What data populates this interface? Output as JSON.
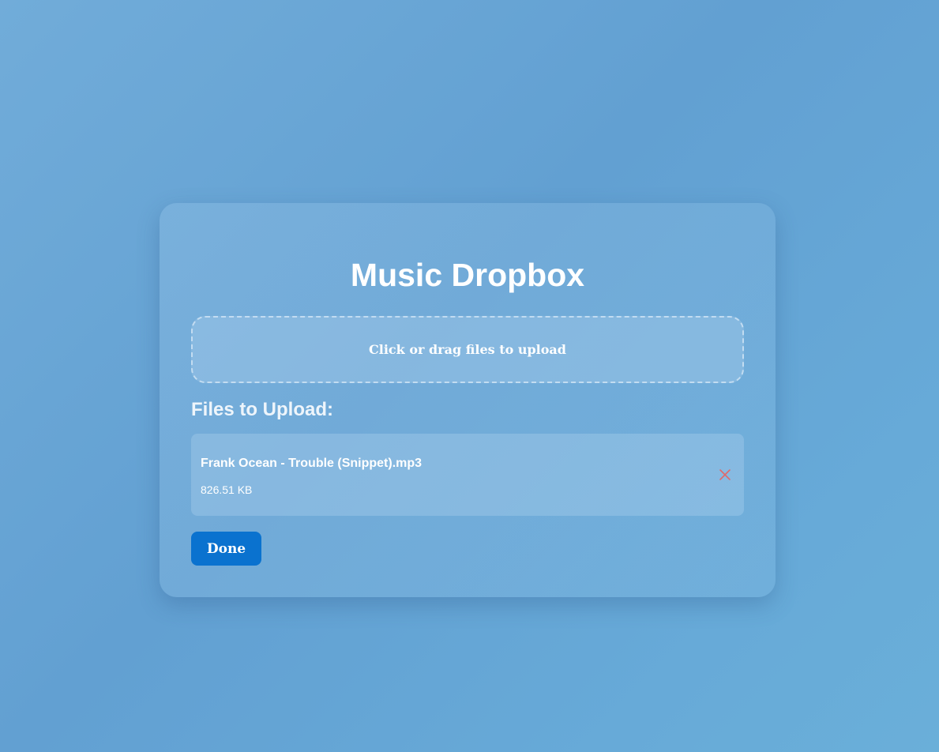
{
  "app": {
    "title": "Music Dropbox"
  },
  "dropzone": {
    "label": "Click or drag files to upload"
  },
  "files_section": {
    "heading": "Files to Upload:",
    "files": [
      {
        "name": "Frank Ocean - Trouble (Snippet).mp3",
        "size": "826.51 KB",
        "remove_icon": "close-icon"
      }
    ]
  },
  "actions": {
    "done_label": "Done"
  },
  "colors": {
    "accent": "#0a72cf",
    "remove": "#e06a6a"
  }
}
